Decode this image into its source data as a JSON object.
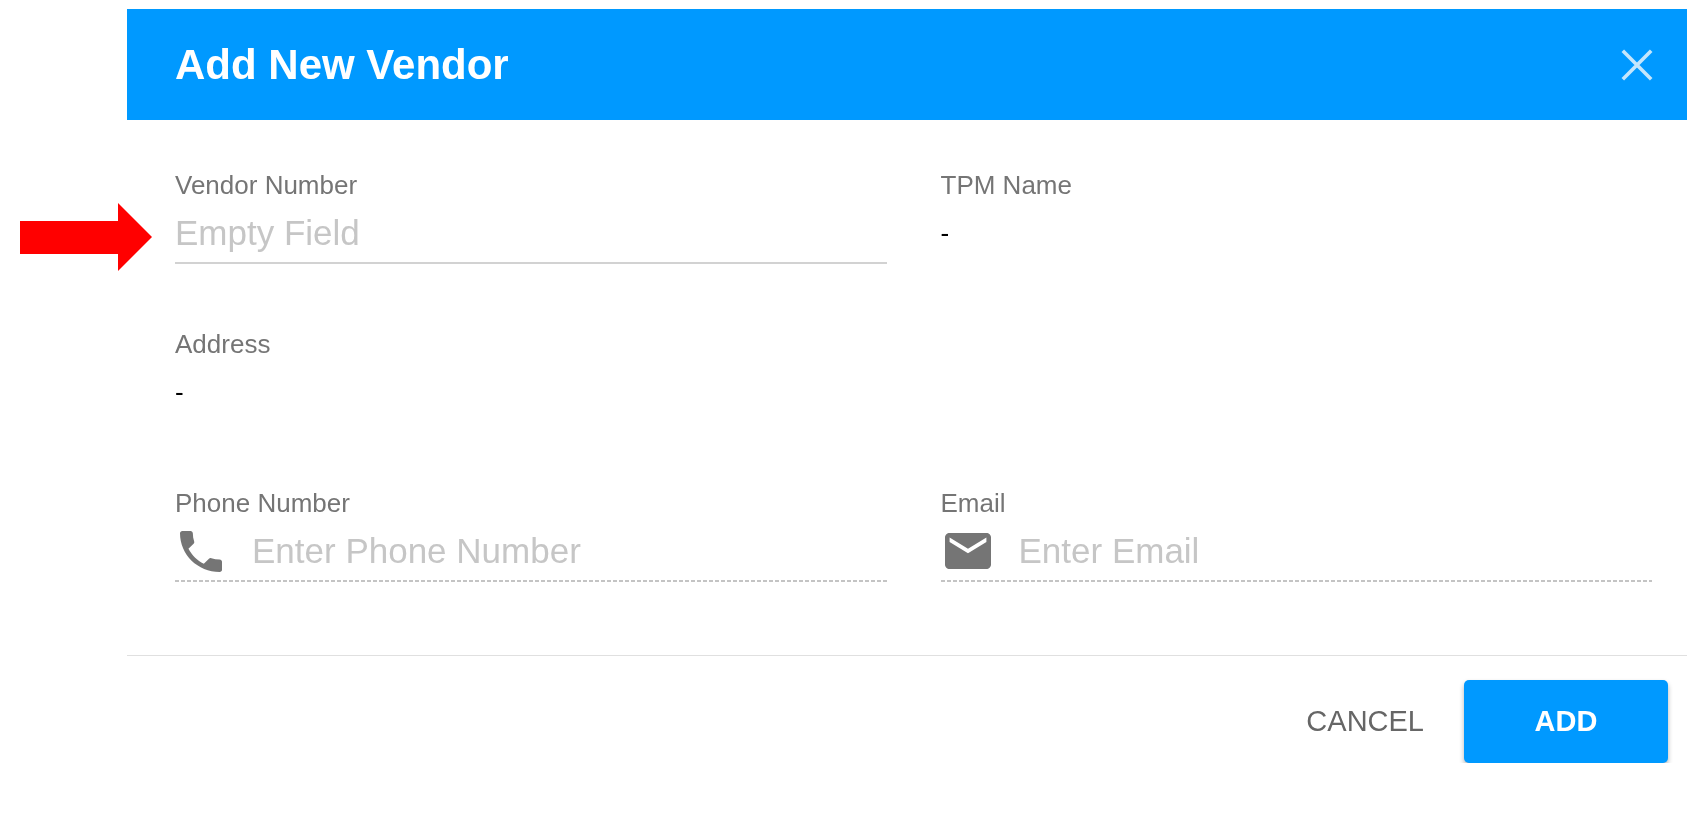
{
  "dialog": {
    "title": "Add New Vendor"
  },
  "rows": [
    [
      {
        "kind": "input",
        "label": "Vendor Number",
        "placeholder": "Empty Field",
        "callout_arrow": true
      },
      {
        "kind": "readonly",
        "label": "TPM Name",
        "value": "-",
        "callout_arrow": false
      }
    ],
    [
      {
        "kind": "readonly",
        "label": "Address",
        "value": "-",
        "callout_arrow": false
      }
    ],
    [
      {
        "kind": "phone",
        "label": "Phone Number",
        "placeholder": "Enter Phone Number",
        "callout_arrow": false
      },
      {
        "kind": "email",
        "label": "Email",
        "placeholder": "Enter Email",
        "callout_arrow": false
      }
    ]
  ],
  "buttons": [
    {
      "kind": "text",
      "label": "CANCEL"
    },
    {
      "kind": "contained",
      "label": "ADD"
    }
  ]
}
